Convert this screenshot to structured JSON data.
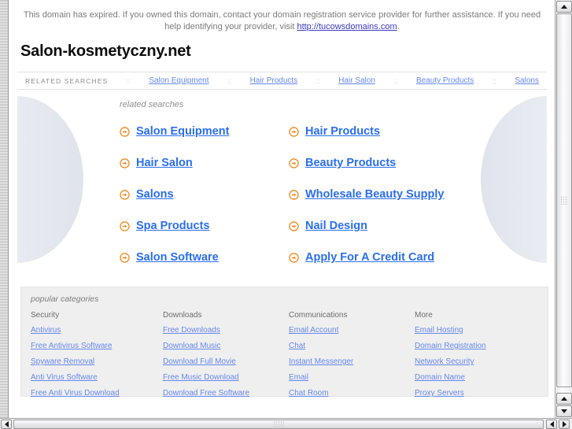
{
  "colors": {
    "link_blue": "#6688ee",
    "heading_link_blue": "#2a6ef0",
    "arrow_orange": "#f08a1e",
    "notice_grey": "#7b7b7b",
    "panel_grey": "#efefef",
    "notice_link": "#3b3bc9"
  },
  "notice": {
    "text_before_link": "This domain has expired. If you owned this domain, contact your domain registration service provider for further assistance. If you need help identifying your provider, visit ",
    "link_text": "http://tucowsdomains.com",
    "text_after_link": "."
  },
  "domain_title": "Salon-kosmetyczny.net",
  "nav": {
    "label": "RELATED SEARCHES",
    "separator": "::",
    "links": [
      "Salon Equipment",
      "Hair Products",
      "Hair Salon",
      "Beauty Products",
      "Salons"
    ]
  },
  "hero": {
    "caption": "related searches",
    "arrow_icon": "circle-arrow-right-icon",
    "items": [
      "Salon Equipment",
      "Hair Products",
      "Hair Salon",
      "Beauty Products",
      "Salons",
      "Wholesale Beauty Supply",
      "Spa Products",
      "Nail Design",
      "Salon Software",
      "Apply For A Credit Card"
    ]
  },
  "categories": {
    "caption": "popular categories",
    "columns": [
      {
        "heading": "Security",
        "links": [
          "Antivirus",
          "Free Antivirus Software",
          "Spyware Removal",
          "Anti Virus Software",
          "Free Anti Virus Download"
        ]
      },
      {
        "heading": "Downloads",
        "links": [
          "Free Downloads",
          "Download Music",
          "Download Full Movie",
          "Free Music Download",
          "Download Free Software"
        ]
      },
      {
        "heading": "Communications",
        "links": [
          "Email Account",
          "Chat",
          "Instant Messenger",
          "Email",
          "Chat Room"
        ]
      },
      {
        "heading": "More",
        "links": [
          "Email Hosting",
          "Domain Registration",
          "Network Security",
          "Domain Name",
          "Proxy Servers"
        ]
      }
    ]
  },
  "chrome": {
    "vscroll_up_icon": "triangle-up-icon",
    "vscroll_down_icon": "triangle-down-icon",
    "hscroll_left_icon": "triangle-left-icon",
    "hscroll_right_icon": "triangle-right-icon"
  }
}
